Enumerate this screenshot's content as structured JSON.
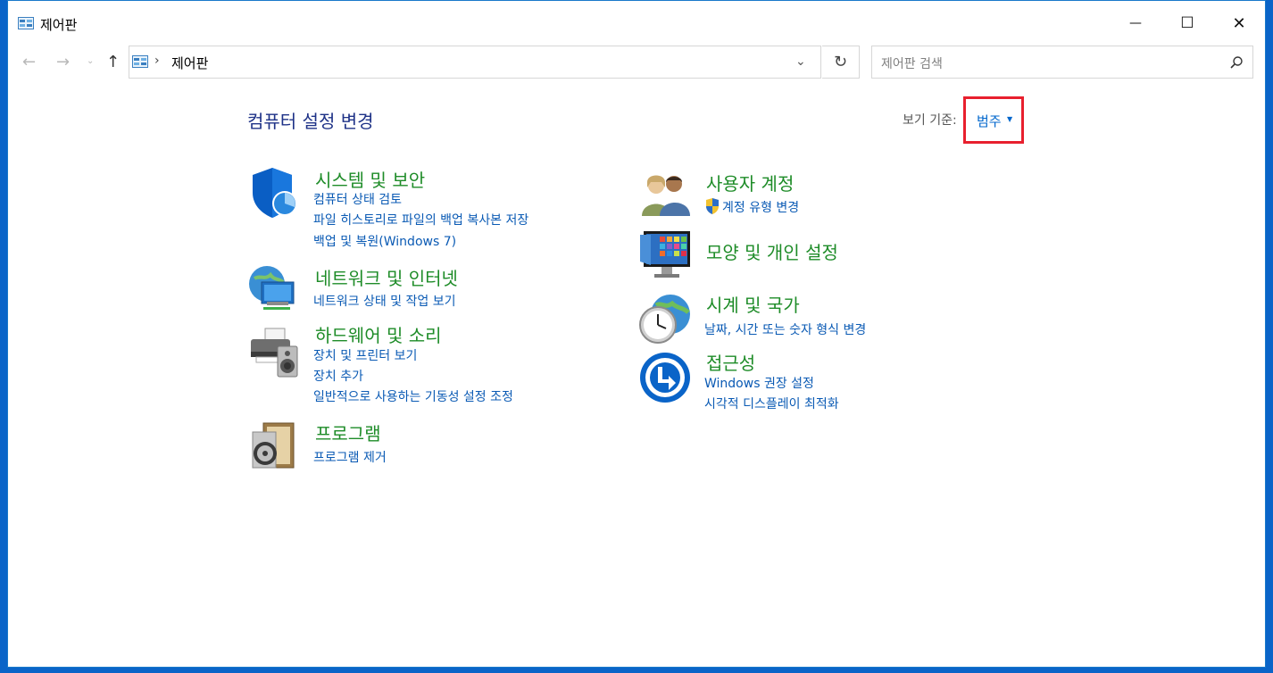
{
  "window": {
    "title": "제어판",
    "minimize": "—",
    "maximize": "☐",
    "close": "✕"
  },
  "nav": {
    "back": "←",
    "forward": "→",
    "recent": "⌄",
    "up": "↑",
    "breadcrumb_sep": "›",
    "address": "제어판",
    "dropdown": "⌄",
    "refresh": "↻",
    "search_placeholder": "제어판 검색"
  },
  "header": {
    "title": "컴퓨터 설정 변경",
    "view_by_label": "보기 기준:",
    "view_by_value": "범주",
    "view_by_caret": "▼"
  },
  "categories": [
    {
      "title": "시스템 및 보안",
      "links": [
        "컴퓨터 상태 검토",
        "파일 히스토리로 파일의 백업 복사본 저장",
        "백업 및 복원(Windows 7)"
      ]
    },
    {
      "title": "네트워크 및 인터넷",
      "links": [
        "네트워크 상태 및 작업 보기"
      ]
    },
    {
      "title": "하드웨어 및 소리",
      "links": [
        "장치 및 프린터 보기",
        "장치 추가",
        "일반적으로 사용하는 기동성 설정 조정"
      ]
    },
    {
      "title": "프로그램",
      "links": [
        "프로그램 제거"
      ]
    },
    {
      "title": "사용자 계정",
      "links": [
        "계정 유형 변경"
      ]
    },
    {
      "title": "모양 및 개인 설정",
      "links": []
    },
    {
      "title": "시계 및 국가",
      "links": [
        "날짜, 시간 또는 숫자 형식 변경"
      ]
    },
    {
      "title": "접근성",
      "links": [
        "Windows 권장 설정",
        "시각적 디스플레이 최적화"
      ]
    }
  ],
  "colors": {
    "accent": "#0a64c8",
    "category_title": "#1e8c28",
    "link": "#0a5ab4",
    "highlight": "#e8202e"
  }
}
